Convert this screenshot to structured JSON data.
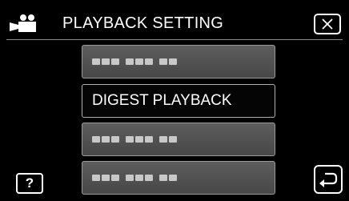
{
  "header": {
    "title": "PLAYBACK SETTING",
    "mode_icon": "video-camera-icon",
    "close_icon": "close-icon"
  },
  "menu": {
    "items": [
      {
        "label": "",
        "state": "disabled"
      },
      {
        "label": "DIGEST PLAYBACK",
        "state": "selected"
      },
      {
        "label": "",
        "state": "disabled"
      },
      {
        "label": "",
        "state": "disabled"
      }
    ]
  },
  "footer": {
    "help_label": "?",
    "help_icon": "help-icon",
    "back_icon": "return-icon"
  }
}
